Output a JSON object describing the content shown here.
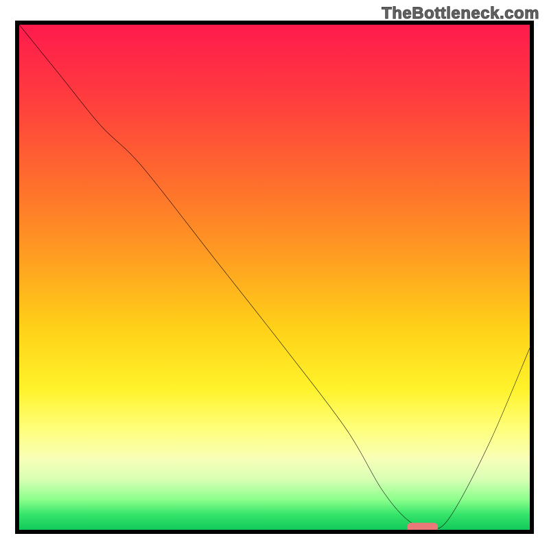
{
  "watermark": "TheBottleneck.com",
  "chart_data": {
    "type": "line",
    "title": "",
    "xlabel": "",
    "ylabel": "",
    "xlim": [
      0,
      100
    ],
    "ylim": [
      0,
      100
    ],
    "grid": false,
    "legend": false,
    "series": [
      {
        "name": "bottleneck-curve",
        "x": [
          0,
          8,
          16,
          24,
          38,
          52,
          64,
          71,
          76,
          80,
          84,
          92,
          100
        ],
        "y": [
          100,
          90,
          80,
          72,
          54,
          36,
          20,
          8,
          2,
          0.5,
          2,
          17,
          36
        ]
      }
    ],
    "marker": {
      "name": "optimal-point",
      "x": 79,
      "y": 0.5,
      "width": 6,
      "color": "#ea7a7a"
    },
    "gradient_stops": [
      {
        "pos": 0.0,
        "color": "#ff1a4d"
      },
      {
        "pos": 0.14,
        "color": "#ff3b3f"
      },
      {
        "pos": 0.3,
        "color": "#ff6a2e"
      },
      {
        "pos": 0.45,
        "color": "#ff9a22"
      },
      {
        "pos": 0.6,
        "color": "#ffd118"
      },
      {
        "pos": 0.72,
        "color": "#fff22a"
      },
      {
        "pos": 0.8,
        "color": "#ffff7a"
      },
      {
        "pos": 0.86,
        "color": "#f8ffb8"
      },
      {
        "pos": 0.9,
        "color": "#d8ffb4"
      },
      {
        "pos": 0.94,
        "color": "#8cff8c"
      },
      {
        "pos": 0.97,
        "color": "#35e46a"
      },
      {
        "pos": 1.0,
        "color": "#12c95a"
      }
    ]
  }
}
